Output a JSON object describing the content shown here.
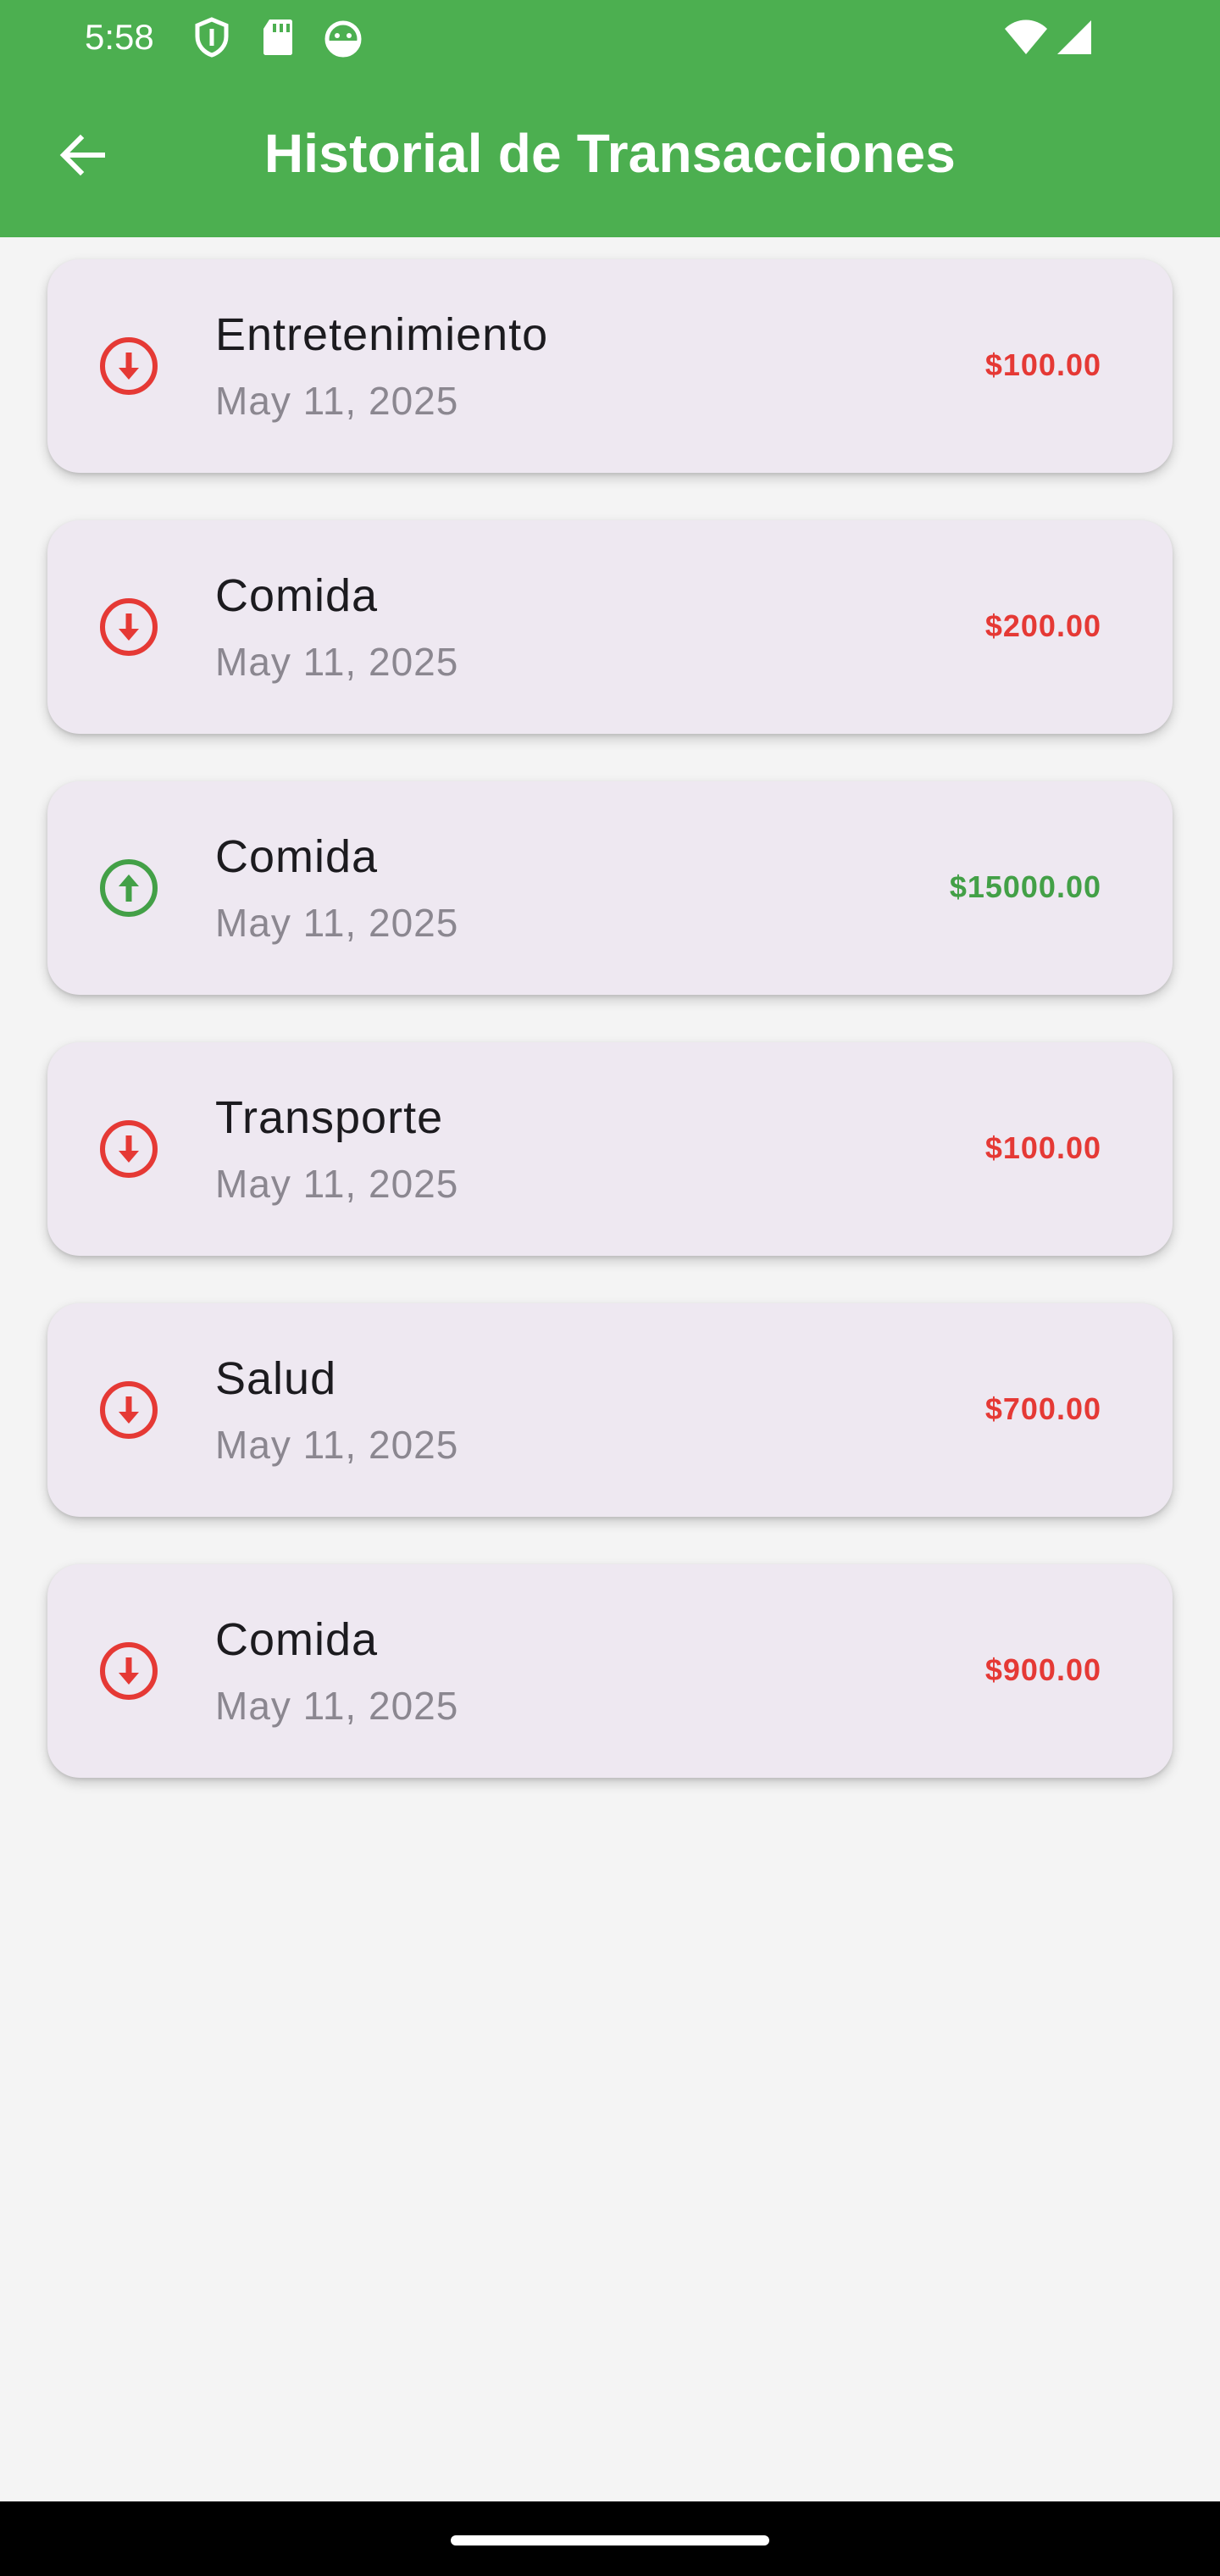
{
  "status_bar": {
    "time": "5:58",
    "left_icons": [
      "shield-icon",
      "sd-card-icon",
      "android-icon"
    ],
    "right_icons": [
      "wifi-icon",
      "signal-icon"
    ]
  },
  "app_bar": {
    "back_icon": "arrow-back-icon",
    "title": "Historial de Transacciones",
    "color": "#4caf50"
  },
  "colors": {
    "expense": "#e53935",
    "income": "#43a047",
    "card_background": "#eee8f1"
  },
  "transactions": [
    {
      "category": "Entretenimiento",
      "date": "May 11, 2025",
      "amount": "$100.00",
      "type": "expense",
      "icon": "arrow-down-circle-icon"
    },
    {
      "category": "Comida",
      "date": "May 11, 2025",
      "amount": "$200.00",
      "type": "expense",
      "icon": "arrow-down-circle-icon"
    },
    {
      "category": "Comida",
      "date": "May 11, 2025",
      "amount": "$15000.00",
      "type": "income",
      "icon": "arrow-up-circle-icon"
    },
    {
      "category": "Transporte",
      "date": "May 11, 2025",
      "amount": "$100.00",
      "type": "expense",
      "icon": "arrow-down-circle-icon"
    },
    {
      "category": "Salud",
      "date": "May 11, 2025",
      "amount": "$700.00",
      "type": "expense",
      "icon": "arrow-down-circle-icon"
    },
    {
      "category": "Comida",
      "date": "May 11, 2025",
      "amount": "$900.00",
      "type": "expense",
      "icon": "arrow-down-circle-icon"
    }
  ]
}
